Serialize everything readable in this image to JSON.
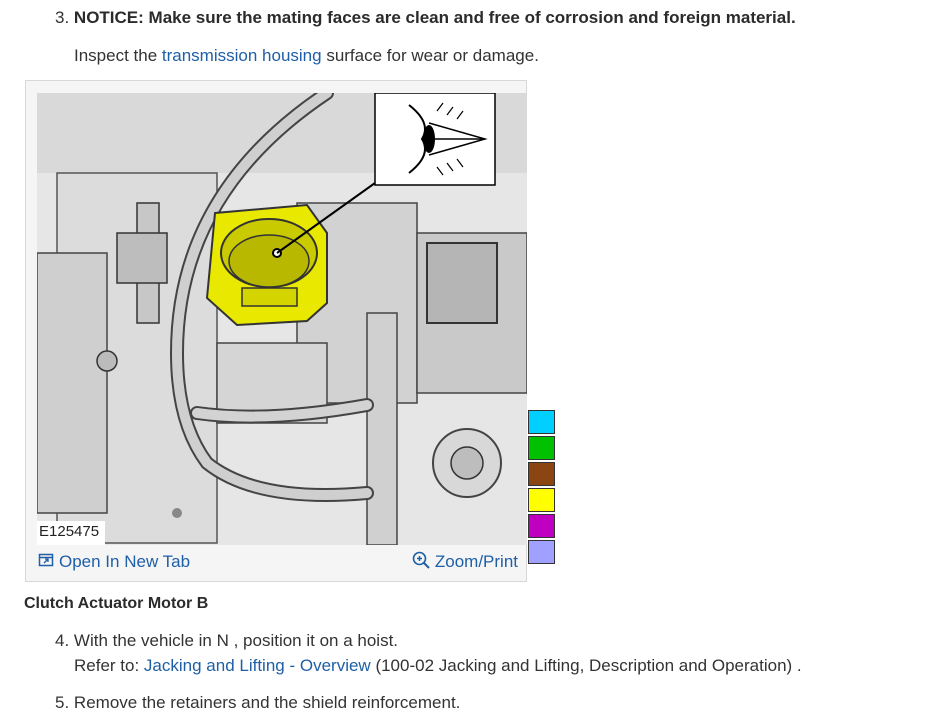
{
  "step3": {
    "number": "3.",
    "notice": "NOTICE: Make sure the mating faces are clean and free of corrosion and foreign material.",
    "inspect_before": "Inspect the ",
    "inspect_link": "transmission housing",
    "inspect_after": " surface for wear or damage."
  },
  "figure": {
    "image_id": "E125475",
    "open_new_tab": "Open In New Tab",
    "zoom_print": "Zoom/Print",
    "swatch_colors": [
      "#00cfff",
      "#00c000",
      "#8b4513",
      "#ffff00",
      "#c000c0",
      "#a0a0ff"
    ]
  },
  "section_title": "Clutch Actuator Motor B",
  "step4": {
    "number": "4.",
    "text": "With the vehicle in N , position it on a hoist.",
    "refer_prefix": "Refer to: ",
    "link1": "Jacking and Lifting",
    "separator": " - ",
    "link2": "Overview",
    "refer_suffix": " (100-02 Jacking and Lifting, Description and Operation) ."
  },
  "step5": {
    "number": "5.",
    "text": "Remove the retainers and the shield reinforcement."
  }
}
